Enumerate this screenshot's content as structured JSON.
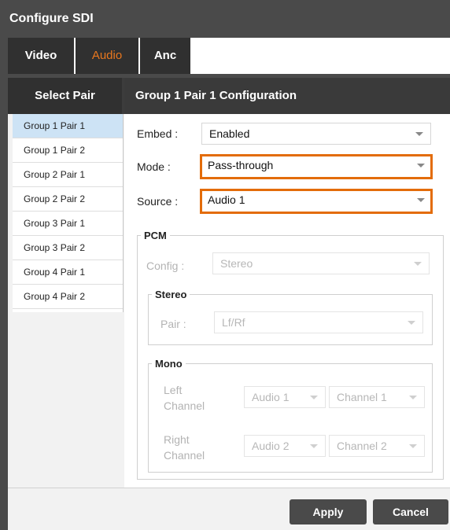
{
  "dialog": {
    "title": "Configure SDI"
  },
  "tabs": [
    {
      "label": "Video"
    },
    {
      "label": "Audio"
    },
    {
      "label": "Anc"
    }
  ],
  "select_pair": {
    "heading": "Select Pair",
    "items": [
      {
        "label": "Group 1 Pair 1",
        "selected": true
      },
      {
        "label": "Group 1 Pair 2"
      },
      {
        "label": "Group 2 Pair 1"
      },
      {
        "label": "Group 2 Pair 2"
      },
      {
        "label": "Group 3 Pair 1"
      },
      {
        "label": "Group 3 Pair 2"
      },
      {
        "label": "Group 4 Pair 1"
      },
      {
        "label": "Group 4 Pair 2"
      }
    ]
  },
  "config": {
    "heading": "Group 1 Pair 1 Configuration",
    "embed": {
      "label": "Embed :",
      "value": "Enabled"
    },
    "mode": {
      "label": "Mode :",
      "value": "Pass-through"
    },
    "source": {
      "label": "Source :",
      "value": "Audio 1"
    },
    "pcm": {
      "legend": "PCM",
      "config": {
        "label": "Config :",
        "value": "Stereo"
      },
      "stereo": {
        "legend": "Stereo",
        "pair": {
          "label": "Pair :",
          "value": "Lf/Rf"
        }
      },
      "mono": {
        "legend": "Mono",
        "left": {
          "label_1": "Left",
          "label_2": "Channel",
          "audio": "Audio 1",
          "channel": "Channel 1"
        },
        "right": {
          "label_1": "Right",
          "label_2": "Channel",
          "audio": "Audio 2",
          "channel": "Channel 2"
        }
      }
    }
  },
  "footer": {
    "apply": "Apply",
    "cancel": "Cancel"
  },
  "colors": {
    "highlight": "#e36c0a",
    "active_tab_text": "#e8771e",
    "selected_item": "#cde3f5"
  }
}
